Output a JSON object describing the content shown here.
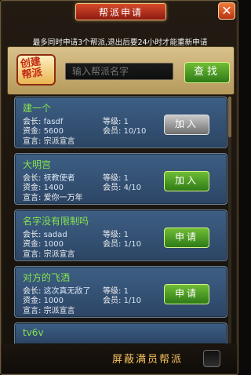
{
  "dialog": {
    "title": "帮派申请",
    "close_glyph": "✕",
    "notice": "最多同时申请3个帮派,退出后要24小时才能重新申请"
  },
  "search": {
    "logo_text_line1": "创建",
    "logo_text_line2": "帮派",
    "placeholder": "输入帮派名字",
    "button_label": "查找"
  },
  "labels": {
    "leader": "会长:",
    "funds": "资金:",
    "level": "等级:",
    "members": "会员:",
    "declaration": "宣言:"
  },
  "guilds": [
    {
      "name": "建一个",
      "leader": "fasdf",
      "funds": "5600",
      "level": "1",
      "members": "10/10",
      "declaration": "宗派宣言",
      "button": "加入",
      "button_style": "gray"
    },
    {
      "name": "大明宫",
      "leader": "祆教使者",
      "funds": "1400",
      "level": "1",
      "members": "4/10",
      "declaration": "爱你一万年",
      "button": "加入",
      "button_style": "green"
    },
    {
      "name": "名字没有限制吗",
      "leader": "sadad",
      "funds": "1000",
      "level": "1",
      "members": "1/10",
      "declaration": "宗派宣言",
      "button": "申请",
      "button_style": "green"
    },
    {
      "name": "对方的飞洒",
      "leader": "这次真无敌了",
      "funds": "1000",
      "level": "1",
      "members": "1/10",
      "declaration": "宗派宣言",
      "button": "申请",
      "button_style": "green"
    },
    {
      "name": "tv6v"
    }
  ],
  "bottom": {
    "filter_label": "屏蔽满员帮派"
  },
  "colors": {
    "title_red": "#8e1a10",
    "green_button": "#2e7a17",
    "card_blue": "#2c4565",
    "name_green": "#86e34d",
    "filter_gold": "#f6c25d"
  }
}
